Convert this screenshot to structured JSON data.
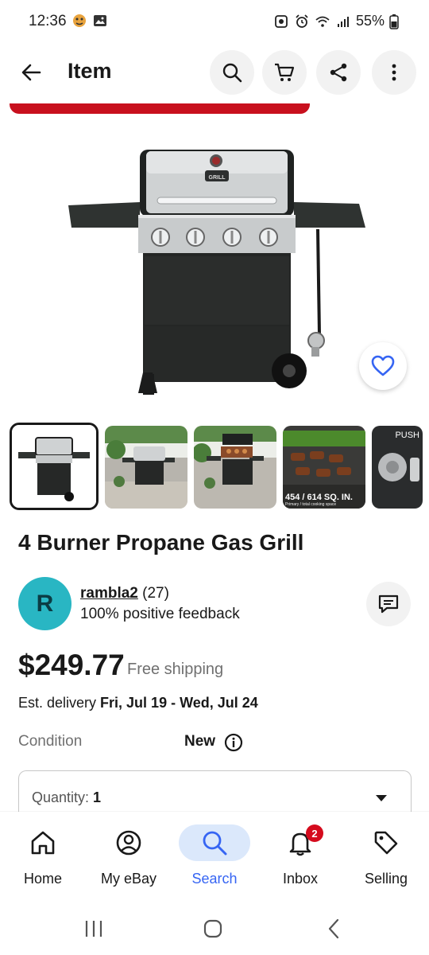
{
  "status_bar": {
    "time": "12:36",
    "battery": "55%"
  },
  "header": {
    "title": "Item",
    "icons": [
      "back-arrow-icon",
      "search-icon",
      "cart-icon",
      "share-icon",
      "more-icon"
    ]
  },
  "hero": {
    "image": "4 burner gas grill product photo",
    "grill_badge": "GRILL"
  },
  "thumbnails": [
    {
      "selected": true
    },
    {
      "selected": false
    },
    {
      "selected": false
    },
    {
      "selected": false,
      "caption": "454 / 614 SQ. IN.",
      "subcaption": "Primary / total cooking space"
    },
    {
      "selected": false,
      "caption": "PUSH"
    }
  ],
  "item": {
    "title": "4 Burner Propane Gas Grill"
  },
  "seller": {
    "initial": "R",
    "name": "rambla2",
    "rating_count": "(27)",
    "feedback": "100% positive feedback"
  },
  "price": {
    "amount": "$249.77",
    "shipping": "Free shipping"
  },
  "delivery": {
    "prefix": "Est. delivery ",
    "range": "Fri, Jul 19 - Wed, Jul 24"
  },
  "condition": {
    "label": "Condition",
    "value": "New"
  },
  "quantity": {
    "label": "Quantity: ",
    "value": "1"
  },
  "bottom_nav": [
    {
      "label": "Home",
      "icon": "home-icon",
      "active": false
    },
    {
      "label": "My eBay",
      "icon": "user-icon",
      "active": false
    },
    {
      "label": "Search",
      "icon": "search-icon",
      "active": true
    },
    {
      "label": "Inbox",
      "icon": "bell-icon",
      "active": false,
      "badge": "2"
    },
    {
      "label": "Selling",
      "icon": "tag-icon",
      "active": false
    }
  ],
  "colors": {
    "accent_blue": "#3665f3",
    "active_nav_bg": "#dbe8fb",
    "avatar_bg": "#29b6c3",
    "red_bar": "#c8101e",
    "badge_red": "#d50b1d"
  }
}
